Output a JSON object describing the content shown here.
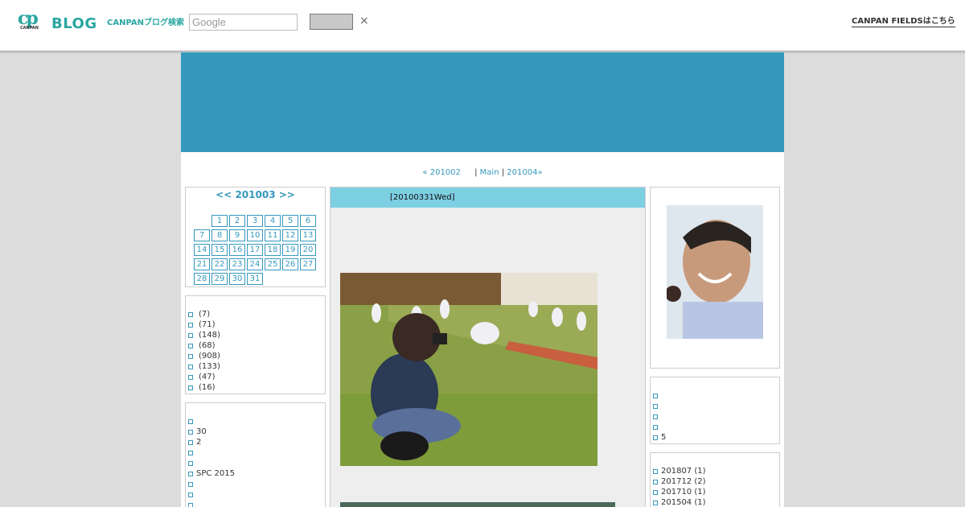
{
  "header": {
    "logo_text": "BLOG",
    "logo_small": "CANPAN",
    "logo_mark": "cp",
    "search_label": "CANPANブログ検索",
    "search_placeholder": "Google",
    "close_glyph": "×",
    "fields_link": "CANPAN FIELDSはこちら"
  },
  "pager": {
    "prev": "« 201002",
    "sep1": "|",
    "main": "Main",
    "sep2": "|",
    "next": "201004»"
  },
  "calendar": {
    "title": "<< 201003 >>",
    "days": [
      "1",
      "2",
      "3",
      "4",
      "5",
      "6",
      "7",
      "8",
      "9",
      "10",
      "11",
      "12",
      "13",
      "14",
      "15",
      "16",
      "17",
      "18",
      "19",
      "20",
      "21",
      "22",
      "23",
      "24",
      "25",
      "26",
      "27",
      "28",
      "29",
      "30",
      "31"
    ]
  },
  "categories": [
    "(7)",
    "(71)",
    "(148)",
    "(68)",
    "(908)",
    "(133)",
    "(47)",
    "(16)"
  ],
  "recent": [
    "",
    "30",
    "2",
    "",
    "",
    "SPC 2015",
    "",
    "",
    ""
  ],
  "post": {
    "date": "[20100331Wed]"
  },
  "comments": [
    "",
    "",
    "",
    "",
    "5"
  ],
  "archives": [
    "201807 (1)",
    "201712 (2)",
    "201710 (1)",
    "201504 (1)"
  ],
  "colors": {
    "accent": "#3598bd",
    "brand": "#2aa6a0",
    "post_header": "#7dcfe2"
  },
  "icons": [
    "close-icon",
    "list-bullet-icon"
  ]
}
